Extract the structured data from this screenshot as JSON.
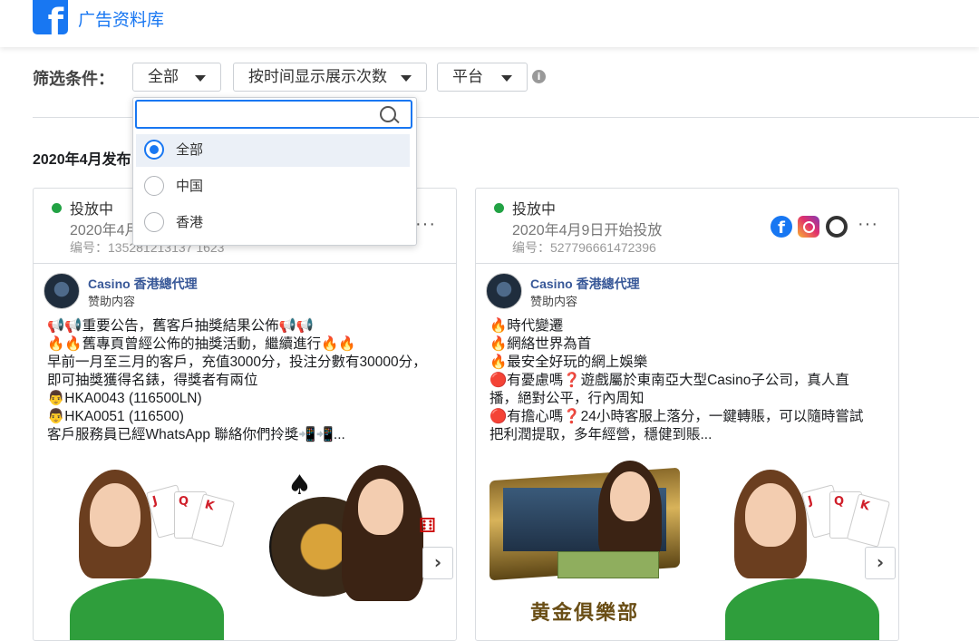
{
  "app": {
    "title": "广告资料库",
    "logo_letter": "f"
  },
  "filters": {
    "label": "筛选条件：",
    "dropdowns": [
      {
        "label": "全部"
      },
      {
        "label": "按时间显示展示次数"
      },
      {
        "label": "平台"
      }
    ],
    "info_glyph": "i",
    "open_panel": {
      "search_placeholder": "",
      "options": [
        {
          "label": "全部",
          "selected": true
        },
        {
          "label": "中国",
          "selected": false
        },
        {
          "label": "香港",
          "selected": false
        }
      ]
    }
  },
  "date_heading": "2020年4月发布",
  "ads": [
    {
      "status": "投放中",
      "start": "2020年4月",
      "id": "编号：135281213137 1623",
      "advertiser": "Casino 香港總代理",
      "sponsored": "赞助内容",
      "body": [
        "📢📢重要公告，舊客戶抽獎結果公佈📢📢",
        "🔥🔥舊專頁曾經公佈的抽獎活動，繼續進行🔥🔥",
        "早前一月至三月的客戶，充值3000分，投注分數有30000分，",
        "即可抽獎獲得名錶，得獎者有兩位",
        "👨HKA0043 (116500LN)",
        "👨HKA0051 (116500)",
        "客戶服務員已經WhatsApp 聯絡你們拎獎📲📲..."
      ],
      "more": "···",
      "next": "›"
    },
    {
      "status": "投放中",
      "start": "2020年4月9日开始投放",
      "id": "编号：527796661472396",
      "advertiser": "Casino 香港總代理",
      "sponsored": "赞助内容",
      "body": [
        "🔥時代變遷",
        "🔥網絡世界為首",
        "🔥最安全好玩的網上娛樂",
        "🔴有憂慮嗎❓遊戲屬於東南亞大型Casino子公司，真人直",
        "播，絕對公平，行內周知",
        "🔴有擔心嗎❓24小時客服上落分，一鍵轉賬，可以隨時嘗試",
        "把利潤提取，多年經營，穩健到賬..."
      ],
      "platforms": [
        "facebook-icon",
        "instagram-icon",
        "audience-network-icon"
      ],
      "more": "···",
      "next": "›",
      "image_caption": "黄金俱樂部"
    }
  ],
  "colors": {
    "brand": "#1877f2",
    "active": "#22a244"
  }
}
